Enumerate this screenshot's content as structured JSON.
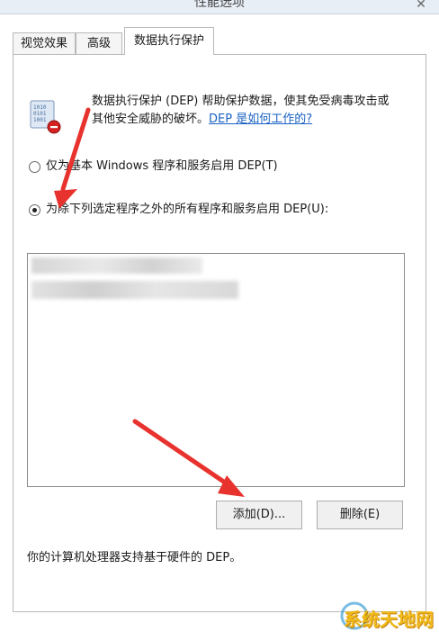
{
  "window": {
    "title": "性能选项",
    "close_symbol": "✕"
  },
  "tabs": [
    {
      "label": "视觉效果"
    },
    {
      "label": "高级"
    },
    {
      "label": "数据执行保护"
    }
  ],
  "dep": {
    "icon": "dep-shield-icon",
    "description_line1": "数据执行保护 (DEP) 帮助保护数据，使其免受病毒攻击或",
    "description_line2": "其他安全威胁的破坏。",
    "help_link": "DEP 是如何工作的?"
  },
  "radio_options": [
    {
      "label": "仅为基本 Windows 程序和服务启用 DEP(T)",
      "selected": false
    },
    {
      "label": "为除下列选定程序之外的所有程序和服务启用 DEP(U):",
      "selected": true
    }
  ],
  "buttons": {
    "add": "添加(D)...",
    "remove": "删除(E)"
  },
  "hardware_note": "你的计算机处理器支持基于硬件的 DEP。",
  "watermark": {
    "text": "系统天地网"
  },
  "colors": {
    "arrow": "#e8322e",
    "link": "#1a62c4",
    "watermark": "#f0b400"
  }
}
